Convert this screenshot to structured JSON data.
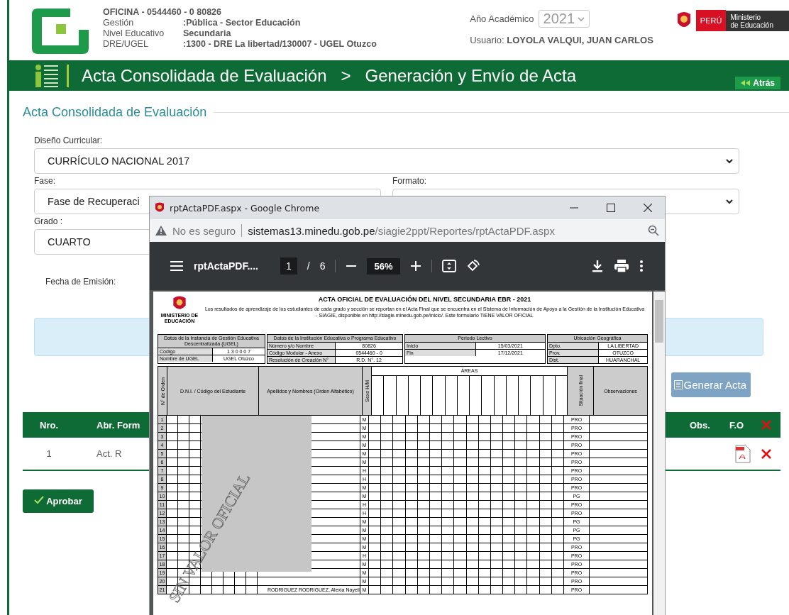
{
  "header": {
    "office": "OFICINA - 0544460 - 0  80826",
    "lines": [
      {
        "label": "Gestión",
        "value": ":Pública - Sector Educación"
      },
      {
        "label": "Nivel Educativo",
        "value": "Secundaria"
      },
      {
        "label": "DRE/UGEL",
        "value": ":1300 - DRE La libertad/130007 - UGEL Otuzco"
      }
    ],
    "year_label": "Año Académico",
    "year": "2021",
    "user_label": "Usuario:",
    "user": "LOYOLA VALQUI, JUAN CARLOS",
    "country": "PERÚ",
    "ministry": [
      "Ministerio",
      "de Educación"
    ]
  },
  "nav": {
    "crumbs": [
      "Acta Consolidada de Evaluación",
      "Generación y Envío de Acta"
    ],
    "separator": ">",
    "back": "Atrás"
  },
  "section_title": "Acta Consolidada de Evaluación",
  "form": {
    "curriculum": {
      "label": "Diseño Curricular:",
      "value": "CURRÍCULO NACIONAL 2017"
    },
    "phase": {
      "label": "Fase:",
      "value": "Fase de Recuperaci"
    },
    "format": {
      "label": "Formato:"
    },
    "grade": {
      "label": "Grado :",
      "value": "CUARTO"
    },
    "date": {
      "label": "Fecha de Emisión:"
    }
  },
  "generate_button": "Generar Acta",
  "table": {
    "columns": [
      "Nro.",
      "Abr. Form",
      "Obs.",
      "F.O"
    ],
    "rows": [
      {
        "nro": "1",
        "abbr": "Act. R"
      }
    ]
  },
  "approve_button": "Aprobar",
  "popup": {
    "title": "rptActaPDF.aspx - Google Chrome",
    "security": "No es seguro",
    "url_host": "sistemas13.minedu.gob.pe",
    "url_path": "/siagie2ppt/Reportes/rptActaPDF.aspx",
    "file": "rptActaPDF....",
    "page": "1",
    "page_sep": "/",
    "pages": "6",
    "zoom": "56%"
  },
  "document": {
    "title": "ACTA OFICIAL DE EVALUACIÓN DEL NIVEL SECUNDARIA EBR - 2021",
    "intro": "Los resultados de aprendizaje de los estudiantes de cada grado y sección se reportan en el Acta Final que se encuentra en el Sistema de Información de Apoyo a la Gestión de la Institución Educativa - SIAGIE, disponible en http://siagie.minedu.gob.pe/inicio/. Este formulario TIENE VALOR OFICIAL",
    "ministry": "MINISTERIO DE EDUCACIÓN",
    "info": [
      {
        "title": "Datos de la Instancia de Gestión Educativa Descentralizada (UGEL)",
        "items": [
          {
            "label": "Código",
            "value": "1 3 0 0 0 7"
          },
          {
            "label": "Nombre de UGEL",
            "value": "UGEL Otuzco"
          }
        ]
      },
      {
        "title": "Datos de la Institución Educativa o Programa Educativo",
        "items": [
          {
            "label": "Número y/o Nombre",
            "value": "80826"
          },
          {
            "label": "Código Modular - Anexo",
            "value": "0544460 - 0"
          },
          {
            "label": "Resolución de Creación N°",
            "value": "R.D. N°. 12"
          }
        ]
      },
      {
        "title": "Periodo Lectivo",
        "items": [
          {
            "label": "Inicio",
            "value": "15/03/2021"
          },
          {
            "label": "Fin",
            "value": "17/12/2021"
          }
        ]
      },
      {
        "title": "Ubicación Geográfica",
        "items": [
          {
            "label": "Dpto.",
            "value": "LA LIBERTAD"
          },
          {
            "label": "Prov.",
            "value": "OTUZCO"
          },
          {
            "label": "Dist.",
            "value": "HUARANCHAL"
          }
        ]
      }
    ],
    "columns": [
      "N° de Orden",
      "D.N.I. / Código del Estudiante",
      "Apellidos y Nombres (Orden Alfabético)",
      "Sexo H/M",
      "ÁREAS",
      "Situación final",
      "Observaciones"
    ],
    "rows": [
      {
        "n": "1",
        "sex": "M",
        "status": "PRO"
      },
      {
        "n": "2",
        "sex": "M",
        "status": "PRO"
      },
      {
        "n": "3",
        "sex": "M",
        "status": "PRO"
      },
      {
        "n": "4",
        "sex": "M",
        "status": "PRO"
      },
      {
        "n": "5",
        "sex": "M",
        "status": "PRO"
      },
      {
        "n": "6",
        "sex": "M",
        "status": "PRO"
      },
      {
        "n": "7",
        "sex": "H",
        "status": "PRO"
      },
      {
        "n": "8",
        "sex": "H",
        "status": "PRO"
      },
      {
        "n": "9",
        "sex": "M",
        "status": "PRO"
      },
      {
        "n": "10",
        "sex": "M",
        "status": "PG"
      },
      {
        "n": "11",
        "sex": "H",
        "status": "PRO"
      },
      {
        "n": "12",
        "sex": "H",
        "status": "PRO"
      },
      {
        "n": "13",
        "sex": "M",
        "status": "PG"
      },
      {
        "n": "14",
        "sex": "M",
        "status": "PG"
      },
      {
        "n": "15",
        "sex": "M",
        "status": "PG"
      },
      {
        "n": "16",
        "sex": "M",
        "status": "PRO"
      },
      {
        "n": "17",
        "sex": "H",
        "status": "PRO"
      },
      {
        "n": "18",
        "sex": "M",
        "status": "PRO"
      },
      {
        "n": "19",
        "sex": "M",
        "status": "PRO"
      },
      {
        "n": "20",
        "sex": "M",
        "status": "PRO"
      },
      {
        "n": "21",
        "sex": "M",
        "status": "PRO",
        "name": "RODRIGUEZ RODRIGUEZ, Alexia Nayeli"
      }
    ],
    "stamp": "SIN VALOR OFICIAL"
  }
}
